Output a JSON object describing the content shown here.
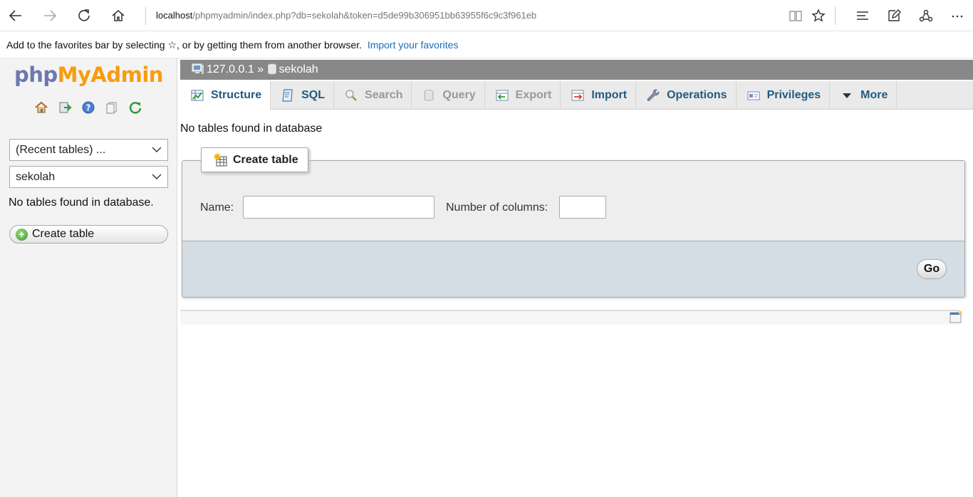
{
  "browser": {
    "url_host": "localhost",
    "url_path": "/phpmyadmin/index.php?db=sekolah&token=d5de99b306951bb63955f6c9c3f961eb",
    "favorites_message": "Add to the favorites bar by selecting ☆, or by getting them from another browser.",
    "favorites_link": "Import your favorites"
  },
  "nav": {
    "logo_php": "php",
    "logo_myadmin": "MyAdmin",
    "recent_tables": "(Recent tables) ...",
    "database_select": "sekolah",
    "empty_message": "No tables found in database.",
    "create_table_label": "Create table"
  },
  "main": {
    "breadcrumb": {
      "server": "127.0.0.1",
      "separator": "»",
      "database": "sekolah"
    },
    "tabs": [
      {
        "label": "Structure",
        "icon": "structure-icon"
      },
      {
        "label": "SQL",
        "icon": "sql-icon"
      },
      {
        "label": "Search",
        "icon": "search-icon"
      },
      {
        "label": "Query",
        "icon": "query-icon"
      },
      {
        "label": "Export",
        "icon": "export-icon"
      },
      {
        "label": "Import",
        "icon": "import-icon"
      },
      {
        "label": "Operations",
        "icon": "wrench-icon"
      },
      {
        "label": "Privileges",
        "icon": "privileges-icon"
      },
      {
        "label": "More",
        "icon": "caret-down-icon"
      }
    ],
    "empty_message": "No tables found in database",
    "create_table": {
      "legend": "Create table",
      "name_label": "Name:",
      "name_value": "",
      "columns_label": "Number of columns:",
      "columns_value": "",
      "go_label": "Go"
    }
  },
  "colors": {
    "tab_text": "#235a81",
    "breadcrumb_bg": "#888888",
    "logo_php": "#6c78af",
    "logo_myadmin": "#f89c0e",
    "fieldset_footer": "#d4dce4"
  }
}
